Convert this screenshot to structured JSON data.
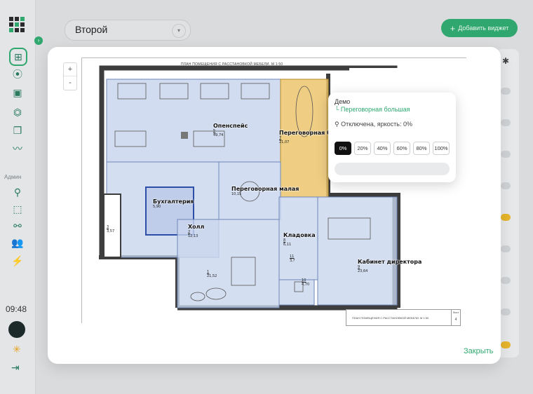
{
  "sidebar": {
    "admin_label": "Админ",
    "clock": "09:48"
  },
  "topbar": {
    "selected_floor": "Второй",
    "add_widget_label": "Добавить виджет"
  },
  "modal": {
    "plan_title": "ПЛАН ПОМЕЩЕНИЯ С РАССТАНОВКОЙ МЕБЕЛИ. М 1:50",
    "stamp_text": "ПЛАН ПОМЕЩЕНИЯ С РАССТАНОВКОЙ МЕБЕЛИ. М 1:50",
    "sheet_label": "Лист",
    "sheet_number": "4",
    "close_label": "Закрыть",
    "zoom_in": "+",
    "zoom_out": "-"
  },
  "rooms": [
    {
      "name": "Опенспейс",
      "number": "5",
      "area": "49,74"
    },
    {
      "name": "Переговорная большая",
      "number": "7",
      "area": "21,07"
    },
    {
      "name": "Переговорная малая",
      "number": "",
      "area": "10,15"
    },
    {
      "name": "Бухгалтерия",
      "number": "",
      "area": "5,90"
    },
    {
      "name": "Холл",
      "number": "2",
      "area": "12,13"
    },
    {
      "name": "Кабинет директора",
      "number": "9",
      "area": "23,64"
    },
    {
      "name": "Кладовка",
      "number": "8",
      "area": "6,11"
    },
    {
      "name": "",
      "number": "3",
      "area": "3,57"
    },
    {
      "name": "",
      "number": "1",
      "area": "21,52"
    },
    {
      "name": "",
      "number": "10",
      "area": "4,70"
    },
    {
      "name": "",
      "number": "11",
      "area": "3,?"
    }
  ],
  "popup": {
    "location_parent": "Демо",
    "location_room": "└ Переговорная большая",
    "status": "Отключена, яркость: 0%",
    "levels": [
      "0%",
      "20%",
      "40%",
      "60%",
      "80%",
      "100%"
    ],
    "selected_level": "0%",
    "brightness": 0
  },
  "colors": {
    "accent": "#2fa76f",
    "room_blue": "#c9d6ee",
    "room_selected": "#ecc56d"
  }
}
